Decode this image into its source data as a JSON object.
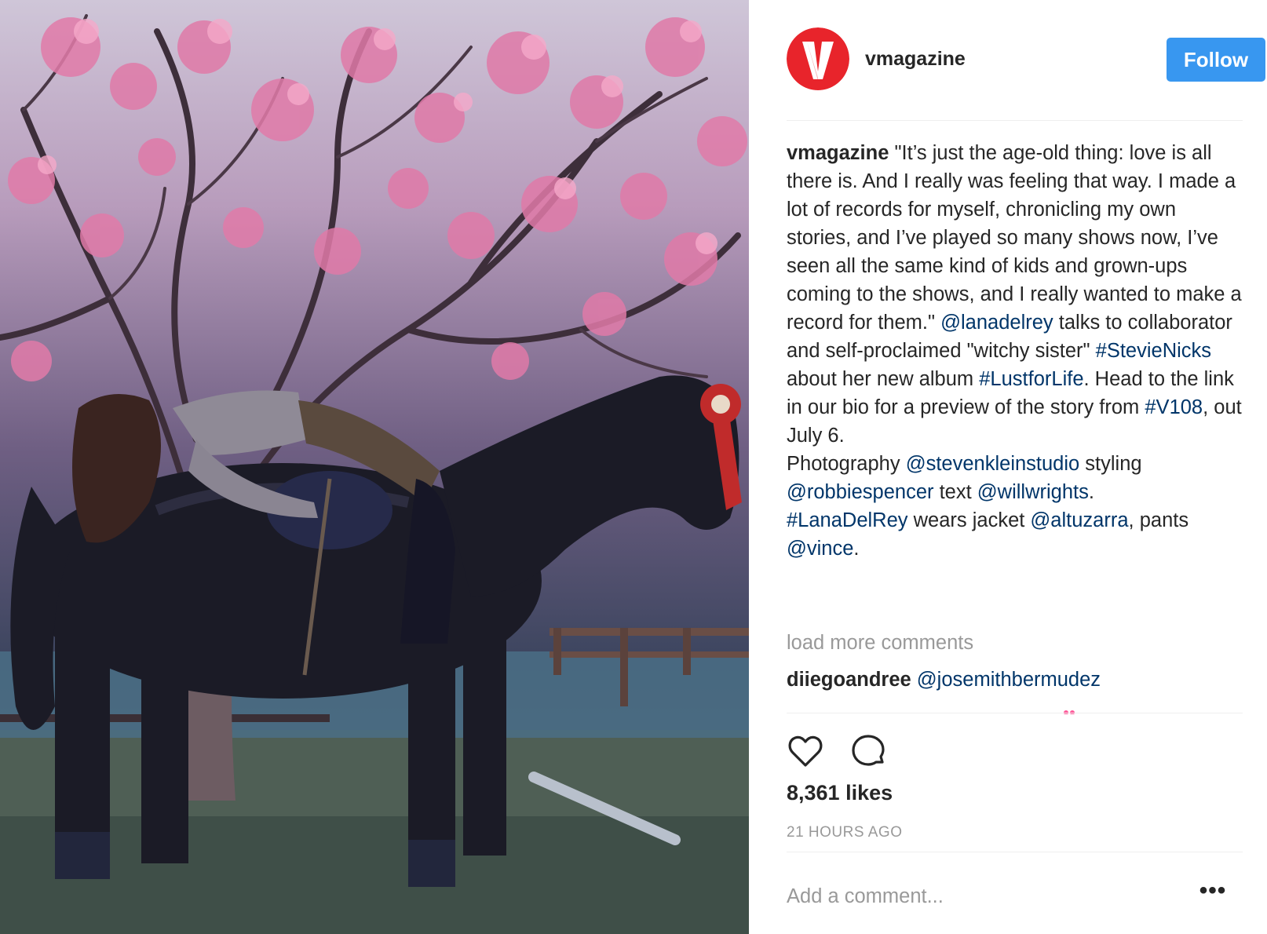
{
  "header": {
    "username": "vmagazine",
    "follow_label": "Follow"
  },
  "caption": {
    "username": "vmagazine",
    "segments": [
      {
        "t": "\"It’s just the age-old thing: love is all there is. And I really was feeling that way. I made a lot of records for myself, chronicling my own stories, and I’ve played so many shows now, I’ve seen all the same kind of kids and grown-ups coming to the shows, and I really wanted to make a record for them.\" "
      },
      {
        "t": "@lanadelrey",
        "link": true
      },
      {
        "t": " talks to collaborator and self-proclaimed \"witchy sister\" "
      },
      {
        "t": "#StevieNicks",
        "link": true
      },
      {
        "t": " about her new album "
      },
      {
        "t": "#LustforLife",
        "link": true
      },
      {
        "t": ". Head to the link in our bio for a preview of the story from "
      },
      {
        "t": "#V108",
        "link": true
      },
      {
        "t": ", out July 6."
      },
      {
        "t": "\n"
      },
      {
        "t": "Photography "
      },
      {
        "t": "@stevenkleinstudio",
        "link": true
      },
      {
        "t": " styling "
      },
      {
        "t": "@robbiespencer",
        "link": true
      },
      {
        "t": " text "
      },
      {
        "t": "@willwrights",
        "link": true
      },
      {
        "t": "."
      },
      {
        "t": "\n"
      },
      {
        "t": "#LanaDelRey",
        "link": true
      },
      {
        "t": " wears jacket "
      },
      {
        "t": "@altuzarra",
        "link": true
      },
      {
        "t": ", pants "
      },
      {
        "t": "@vince",
        "link": true
      },
      {
        "t": "."
      }
    ]
  },
  "comments": {
    "load_more_label": "load more comments",
    "items": [
      {
        "username": "diiegoandree",
        "text": "@josemithbermudez"
      }
    ]
  },
  "actions": {
    "like_icon": "heart-icon",
    "comment_icon": "speech-bubble-icon"
  },
  "likes_label": "8,361 likes",
  "timestamp": "21 HOURS AGO",
  "add_comment_placeholder": "Add a comment...",
  "more_label": "•••",
  "colors": {
    "follow_button": "#3897f0",
    "link": "#003569",
    "muted": "#999999",
    "brand_red": "#e8242b"
  }
}
